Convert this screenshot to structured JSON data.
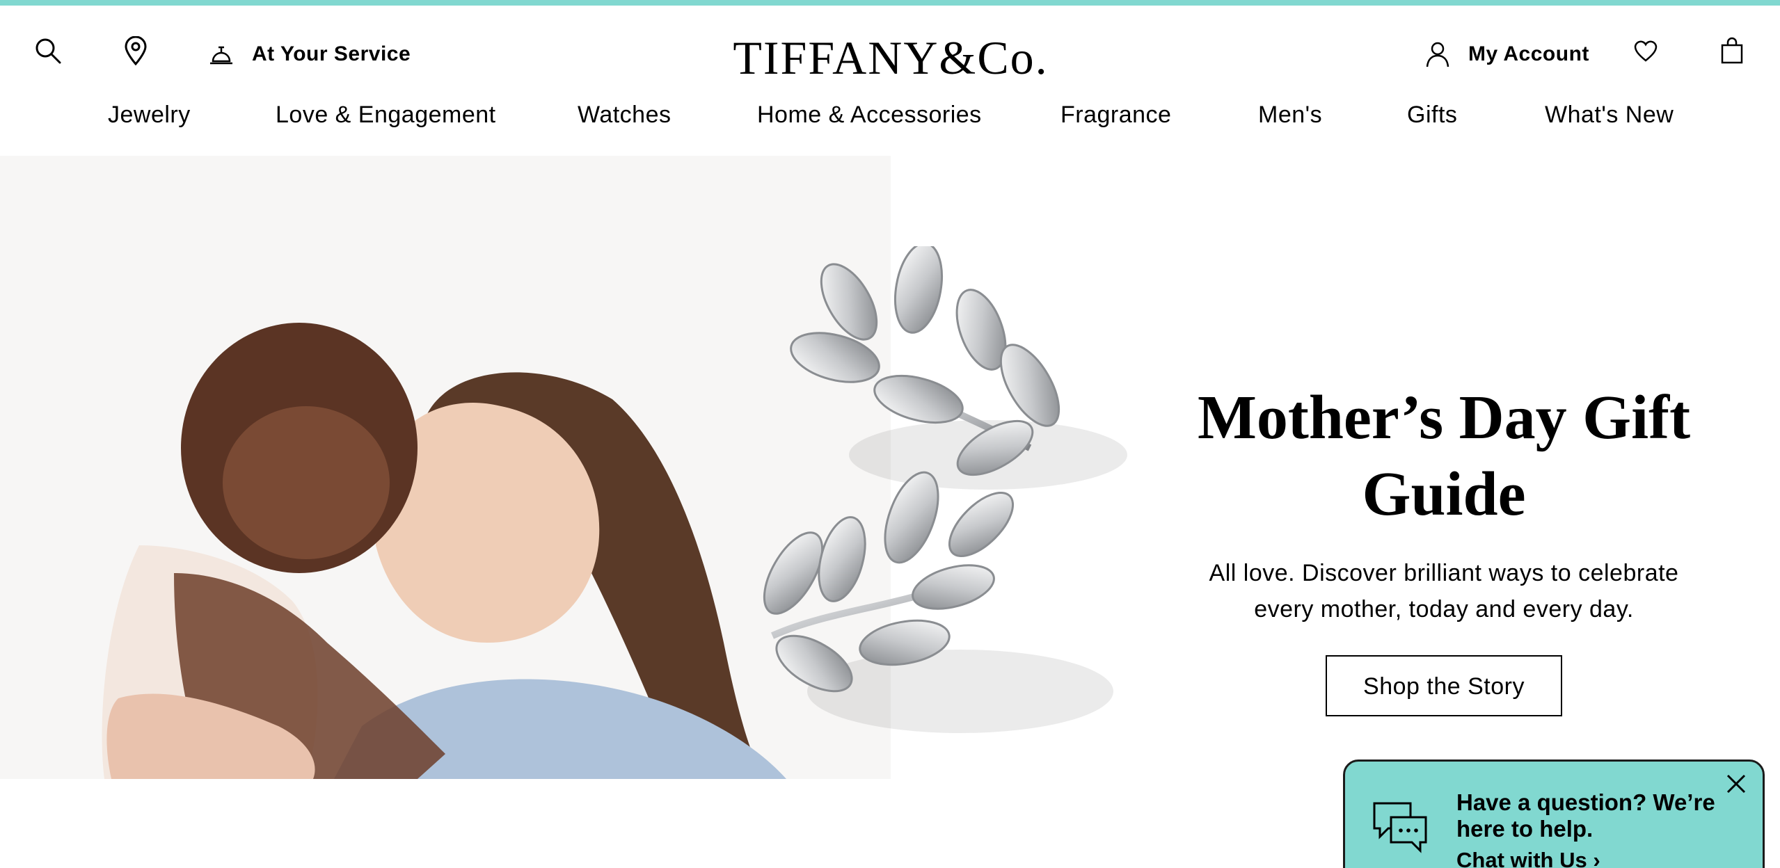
{
  "brand": {
    "logo_text": "TIFFANY&Co.",
    "accent_color": "#81d8d0"
  },
  "utility": {
    "search_icon": "search-icon",
    "location_icon": "map-pin-icon",
    "service_icon": "service-bell-icon",
    "service_label": "At Your Service",
    "account_icon": "user-icon",
    "account_label": "My Account",
    "wishlist_icon": "heart-icon",
    "bag_icon": "shopping-bag-icon"
  },
  "nav": {
    "items": [
      {
        "label": "Jewelry"
      },
      {
        "label": "Love & Engagement"
      },
      {
        "label": "Watches"
      },
      {
        "label": "Home & Accessories"
      },
      {
        "label": "Fragrance"
      },
      {
        "label": "Men's"
      },
      {
        "label": "Gifts"
      },
      {
        "label": "What's New"
      }
    ]
  },
  "hero": {
    "title": "Mother’s Day Gift Guide",
    "body": "All love. Discover brilliant ways to celebrate every mother, today and every day.",
    "cta_label": "Shop the Story"
  },
  "chat": {
    "icon": "chat-bubbles-icon",
    "title": "Have a question? We’re here to help.",
    "link_label": "Chat with Us  ›",
    "close_icon": "close-icon",
    "bg_color": "#81d8d0"
  }
}
